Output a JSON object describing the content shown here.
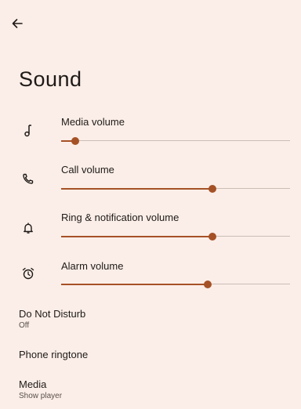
{
  "page": {
    "title": "Sound",
    "back_icon": "arrow-left-icon",
    "accent_color": "#a55126",
    "background_color": "#fbeee8"
  },
  "volumes": [
    {
      "label": "Media volume",
      "icon": "music-note-icon",
      "level": 0.06
    },
    {
      "label": "Call volume",
      "icon": "phone-icon",
      "level": 0.66
    },
    {
      "label": "Ring & notification volume",
      "icon": "bell-icon",
      "level": 0.66
    },
    {
      "label": "Alarm volume",
      "icon": "alarm-clock-icon",
      "level": 0.64
    }
  ],
  "preferences": [
    {
      "title": "Do Not Disturb",
      "summary": "Off"
    },
    {
      "title": "Phone ringtone",
      "summary": ""
    },
    {
      "title": "Media",
      "summary": "Show player"
    }
  ]
}
